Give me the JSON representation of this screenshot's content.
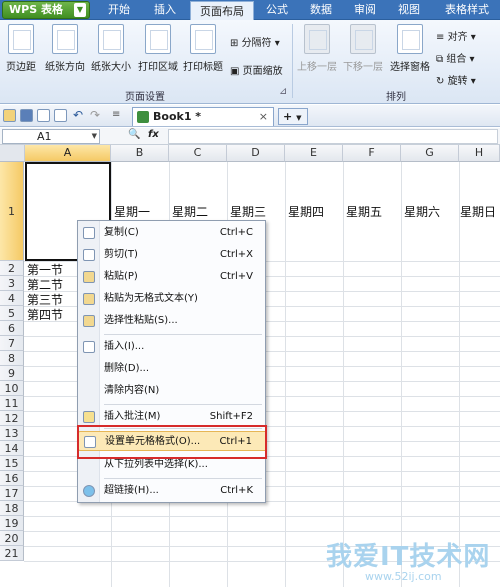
{
  "app": {
    "name": "WPS 表格"
  },
  "menu_tabs": [
    "开始",
    "插入",
    "页面布局",
    "公式",
    "数据",
    "审阅",
    "视图",
    "表格样式"
  ],
  "ribbon": {
    "buttons": [
      "页边距",
      "纸张方向",
      "纸张大小",
      "打印区域",
      "打印标题",
      "上移一层",
      "下移一层",
      "选择窗格"
    ],
    "small": {
      "separator": "分隔符",
      "page_zoom": "页面缩放",
      "align": "对齐",
      "group": "组合",
      "rotate": "旋转"
    },
    "groups": {
      "page_setup": "页面设置",
      "arrange": "排列"
    }
  },
  "doc": {
    "tab_title": "Book1 *",
    "close": "×",
    "add": "+"
  },
  "formula_bar": {
    "name_box": "A1",
    "fx": "fx"
  },
  "columns": [
    "A",
    "B",
    "C",
    "D",
    "E",
    "F",
    "G",
    "H"
  ],
  "rows": [
    "1",
    "2",
    "3",
    "4",
    "5",
    "6",
    "7",
    "8",
    "9",
    "10",
    "11",
    "12",
    "13",
    "14",
    "15",
    "16",
    "17",
    "18",
    "19",
    "20",
    "21"
  ],
  "weekdays": [
    "星期一",
    "星期二",
    "星期三",
    "星期四",
    "星期五",
    "星期六",
    "星期日"
  ],
  "periods": [
    "第一节",
    "第二节",
    "第三节",
    "第四节"
  ],
  "context_menu": [
    {
      "label": "复制(C)",
      "key": "Ctrl+C"
    },
    {
      "label": "剪切(T)",
      "key": "Ctrl+X"
    },
    {
      "label": "粘贴(P)",
      "key": "Ctrl+V"
    },
    {
      "label": "粘贴为无格式文本(Y)",
      "key": ""
    },
    {
      "label": "选择性粘贴(S)...",
      "key": ""
    },
    {
      "label": "插入(I)...",
      "key": ""
    },
    {
      "label": "删除(D)...",
      "key": ""
    },
    {
      "label": "清除内容(N)",
      "key": ""
    },
    {
      "label": "插入批注(M)",
      "key": "Shift+F2"
    },
    {
      "label": "设置单元格格式(O)...",
      "key": "Ctrl+1"
    },
    {
      "label": "从下拉列表中选择(K)...",
      "key": ""
    },
    {
      "label": "超链接(H)...",
      "key": "Ctrl+K"
    }
  ],
  "watermark": {
    "title": "我爱IT技术网",
    "url": "www.52ij.com"
  }
}
